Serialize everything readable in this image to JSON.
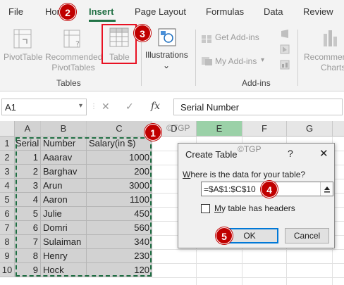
{
  "ribbon": {
    "tabs": [
      "File",
      "Home",
      "Insert",
      "Page Layout",
      "Formulas",
      "Data",
      "Review"
    ],
    "active_tab": "Insert",
    "groups": {
      "tables": {
        "label": "Tables",
        "buttons": {
          "pivot": "PivotTable",
          "recommended_1": "Recommended",
          "recommended_2": "PivotTables",
          "table": "Table"
        }
      },
      "illustrations": {
        "label": "Illustrations",
        "dropdown": "⌄"
      },
      "addins": {
        "label": "Add-ins",
        "get": "Get Add-ins",
        "my": "My Add-ins"
      },
      "charts": {
        "line1": "Recommen",
        "line2": "Charts"
      }
    }
  },
  "formula_bar": {
    "name_box": "A1",
    "formula": "Serial Number",
    "cancel_icon": "close-icon",
    "enter_icon": "check-icon",
    "fx": "fx"
  },
  "sheet": {
    "columns": [
      "A",
      "B",
      "C",
      "D",
      "E",
      "F",
      "G"
    ],
    "rows": [
      "1",
      "2",
      "3",
      "4",
      "5",
      "6",
      "7",
      "8",
      "9",
      "10"
    ],
    "headers": [
      "Serial",
      "Number",
      "Salary(in $)"
    ],
    "data": [
      [
        "1",
        "Aaarav",
        "1000"
      ],
      [
        "2",
        "Barghav",
        "200"
      ],
      [
        "3",
        "Arun",
        "3000"
      ],
      [
        "4",
        "Aaron",
        "1100"
      ],
      [
        "5",
        "Julie",
        "450"
      ],
      [
        "6",
        "Domri",
        "560"
      ],
      [
        "7",
        "Sulaiman",
        "340"
      ],
      [
        "8",
        "Henry",
        "230"
      ],
      [
        "9",
        "Hock",
        "120"
      ]
    ],
    "watermark_1": "©TGP",
    "watermark_2": "©TGP"
  },
  "dialog": {
    "title": "Create Table",
    "help": "?",
    "close": "✕",
    "question_prefix": "W",
    "question_rest": "here is the data for your table?",
    "range": "=$A$1:$C$10",
    "checkbox_prefix": "M",
    "checkbox_rest": "y table has headers",
    "ok": "OK",
    "cancel": "Cancel"
  },
  "steps": [
    "1",
    "2",
    "3",
    "4",
    "5"
  ],
  "colors": {
    "accent": "#217346",
    "step_red": "#c00000",
    "ok_border": "#0078d7",
    "selected_column": "#9bd1a8"
  }
}
